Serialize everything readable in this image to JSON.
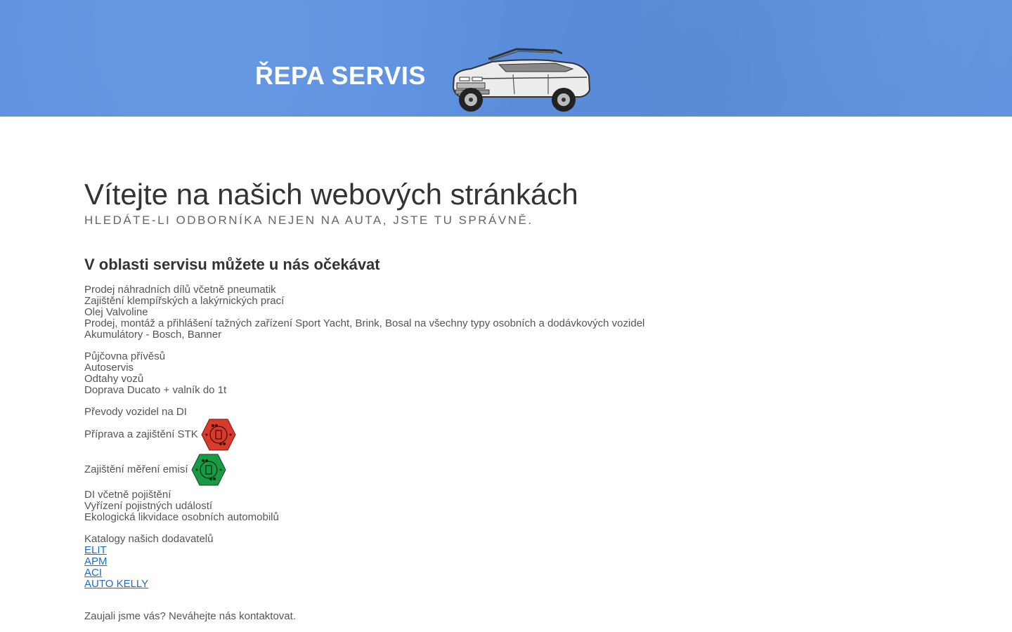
{
  "header": {
    "logo": "ŘEPA SERVIS",
    "car_image": "convertible-car-illustration"
  },
  "main": {
    "title": "Vítejte na našich webových stránkách",
    "subtitle": "HLEDÁTE-LI ODBORNÍKA NEJEN NA AUTA, JSTE TU SPRÁVNĚ.",
    "section_title": "V oblasti servisu můžete u nás očekávat",
    "group1": [
      "Prodej náhradních dílů včetně pneumatik",
      "Zajištění klempířských a lakýrnických prací",
      "Olej Valvoline",
      "Prodej, montáž a přihlášení tažných zařízení Sport Yacht, Brink, Bosal na všechny typy osobních a dodávkových vozidel",
      "Akumulátory - Bosch, Banner"
    ],
    "group2": [
      "Půjčovna přívěsů",
      "Autoservis",
      "Odtahy vozů",
      "Doprava Ducato + valník do 1t"
    ],
    "group3": {
      "line1": "Převody vozidel na DI",
      "stk": "Příprava a zajištění STK",
      "emise": "Zajištění měření emisí"
    },
    "group4": [
      "DI včetně pojištění",
      "Vyřízení pojistných událostí",
      "Ekologická likvidace osobních automobilů"
    ],
    "catalogs_label": "Katalogy našich dodavatelů",
    "catalogs": [
      "ELIT",
      "APM",
      "ACI",
      "AUTO KELLY"
    ],
    "contact": "Zaujali jsme vás? Neváhejte nás kontaktovat."
  },
  "colors": {
    "header_bg": "#5b90e0",
    "stk_badge": "#d93a2b",
    "emise_badge": "#1a9a45",
    "link": "#1a6bcc"
  }
}
